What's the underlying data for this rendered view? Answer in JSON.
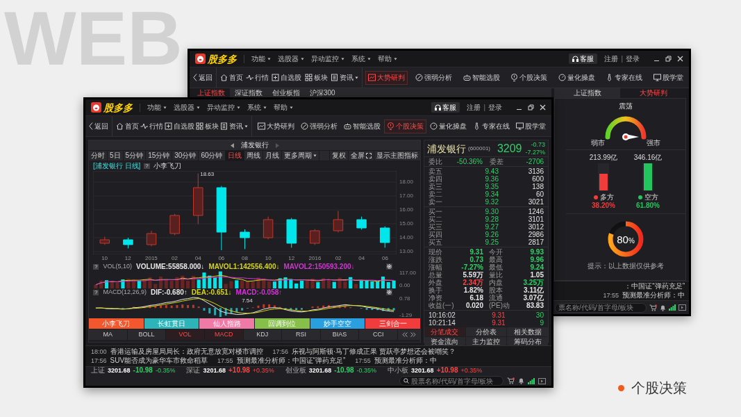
{
  "background_text": "WEB",
  "caption": "个股决策",
  "back_window": {
    "logo": "股多多",
    "menus": [
      "功能",
      "选股器",
      "异动监控",
      "系统",
      "帮助"
    ],
    "service_button": "客服",
    "register": "注册",
    "separator": "|",
    "login": "登录",
    "back_button": "返回",
    "toolbar_left": [
      {
        "label": "首页",
        "dropdown": false
      },
      {
        "label": "行情",
        "dropdown": false
      },
      {
        "label": "自选股",
        "dropdown": false
      },
      {
        "label": "板块",
        "dropdown": false
      },
      {
        "label": "资讯",
        "dropdown": true
      }
    ],
    "toolbar_right": [
      {
        "label": "大势研判",
        "selected": true
      },
      {
        "label": "强弱分析",
        "selected": false
      },
      {
        "label": "智能选股",
        "selected": false
      },
      {
        "label": "个股决策",
        "selected": false
      },
      {
        "label": "量化操盘",
        "selected": false
      },
      {
        "label": "专家在线",
        "selected": false
      },
      {
        "label": "股学堂",
        "selected": false
      }
    ],
    "index_tabs": [
      {
        "label": "上证指数",
        "selected": true
      },
      {
        "label": "深证指数",
        "selected": false
      },
      {
        "label": "创业板指",
        "selected": false
      },
      {
        "label": "沪深300",
        "selected": false
      }
    ],
    "side_tabs": [
      {
        "label": "上证指数",
        "selected": false
      },
      {
        "label": "大势研判",
        "selected": true
      }
    ],
    "gauge": {
      "title": "震荡",
      "left_label": "弱市",
      "right_label": "强市"
    },
    "balance": [
      {
        "amount": "213.99亿",
        "label": "多方",
        "share": "38.20%",
        "color": "#f23b3b",
        "level": 0.62
      },
      {
        "amount": "346.16亿",
        "label": "空方",
        "share": "61.80%",
        "color": "#22c55e",
        "level": 1
      }
    ],
    "donut": {
      "value": "80",
      "unit": "%",
      "level": 0.8
    },
    "tip": "提示：以上数据仅供参考",
    "ticker": [
      {
        "text": "：中国证“弹药充足”"
      },
      {
        "time": "17:55",
        "text": "预测最准分析师：中"
      }
    ],
    "search": {
      "placeholder": "票名称/代码/首字母/板块"
    }
  },
  "front_window": {
    "logo": "股多多",
    "menus": [
      "功能",
      "选股器",
      "异动监控",
      "系统",
      "帮助"
    ],
    "service_button": "客服",
    "register": "注册",
    "separator": "|",
    "login": "登录",
    "back_button": "返回",
    "toolbar_left": [
      {
        "label": "首页",
        "dropdown": false
      },
      {
        "label": "行情",
        "dropdown": false
      },
      {
        "label": "自选股",
        "dropdown": false
      },
      {
        "label": "板块",
        "dropdown": false
      },
      {
        "label": "资讯",
        "dropdown": true
      }
    ],
    "toolbar_right": [
      {
        "label": "大势研判",
        "selected": false
      },
      {
        "label": "强弱分析",
        "selected": false
      },
      {
        "label": "智能选股",
        "selected": false
      },
      {
        "label": "个股决策",
        "selected": true
      },
      {
        "label": "量化操盘",
        "selected": false
      },
      {
        "label": "专家在线",
        "selected": false
      },
      {
        "label": "股学堂",
        "selected": false
      }
    ],
    "chart": {
      "stock_title": "浦发银行",
      "periods": [
        {
          "label": "分时",
          "selected": false
        },
        {
          "label": "5日",
          "selected": false
        },
        {
          "label": "5分钟",
          "selected": false
        },
        {
          "label": "15分钟",
          "selected": false
        },
        {
          "label": "30分钟",
          "selected": false
        },
        {
          "label": "60分钟",
          "selected": false
        },
        {
          "label": "日线",
          "selected": true
        },
        {
          "label": "周线",
          "selected": false
        },
        {
          "label": "月线",
          "selected": false
        },
        {
          "label": "更多周期",
          "selected": false
        }
      ],
      "tools": [
        "复权",
        "全屏",
        "显示主图指标"
      ],
      "legend": {
        "series": "[浦发银行 日线]",
        "help": "?",
        "indicator": "小李飞刀"
      },
      "chart_data": {
        "type": "candlestick",
        "grid": true,
        "categories": [
          "10",
          "12",
          "2015",
          "02",
          "04",
          "06",
          "08",
          "10",
          "12",
          "2016",
          "02",
          "04",
          "06"
        ],
        "ohlc": [
          [
            13.6,
            14.07,
            13.48,
            13.85
          ],
          [
            13.85,
            14.0,
            13.23,
            13.5
          ],
          [
            13.5,
            14.5,
            13.38,
            14.3
          ],
          [
            14.3,
            15.72,
            14.18,
            15.6
          ],
          [
            15.6,
            18.63,
            14.98,
            17.6
          ],
          [
            17.6,
            17.72,
            13.1,
            14.4
          ],
          [
            14.4,
            14.6,
            13.18,
            14.0
          ],
          [
            14.0,
            15.52,
            13.88,
            15.3
          ],
          [
            15.3,
            15.42,
            13.28,
            13.6
          ],
          [
            13.6,
            14.62,
            13.48,
            14.5
          ],
          [
            14.5,
            15.92,
            14.38,
            15.3
          ],
          [
            15.3,
            15.52,
            14.58,
            14.7
          ],
          [
            14.7,
            14.82,
            13.28,
            13.65
          ]
        ],
        "ylim": [
          12.8,
          18.8
        ],
        "yticks": [
          {
            "value": 18,
            "label": "18.00"
          },
          {
            "value": 17,
            "label": "17.00"
          },
          {
            "value": 16,
            "label": "16.00"
          },
          {
            "value": 15,
            "label": "15.00"
          },
          {
            "value": 14,
            "label": "14.00"
          },
          {
            "value": 13,
            "label": "13.00"
          }
        ],
        "annotations": [
          "18.63"
        ]
      },
      "volume": {
        "help": "?",
        "title": "VOL(5,10)",
        "items": [
          {
            "text": "VOLUME:55858.000↓",
            "color": "#e8e8e8"
          },
          {
            "text": "MAVOL1:142556.400↓",
            "color": "#d6d617"
          },
          {
            "text": "MAVOL2:150593.200↓",
            "color": "#d633d6"
          }
        ],
        "axis": [
          "117.00",
          "0.00"
        ]
      },
      "macd": {
        "help": "?",
        "title": "MACD(12,26,9)",
        "items": [
          {
            "text": "DIF:-0.680↑",
            "color": "#e8e8e8"
          },
          {
            "text": "DEA:-0.651↓",
            "color": "#d6d617"
          },
          {
            "text": "MACD:-0.058↑",
            "color": "#d633d6"
          }
        ],
        "axis": [
          "0.78",
          "-1.29"
        ],
        "peak_label": "7.54"
      },
      "strategies": [
        {
          "label": "小李飞刀",
          "color": "#f2572d"
        },
        {
          "label": "长虹贯日",
          "color": "#2eb3b8"
        },
        {
          "label": "仙人指路",
          "color": "#f07aa6"
        },
        {
          "label": "回调到位",
          "color": "#86bf4a"
        },
        {
          "label": "妙手空空",
          "color": "#2a9fe0"
        },
        {
          "label": "三剑合一",
          "color": "#f03c3c"
        }
      ],
      "indicators": [
        {
          "label": "MA",
          "selected": false
        },
        {
          "label": "BOLL",
          "selected": false
        },
        {
          "label": "VOL",
          "selected": true
        },
        {
          "label": "MACD",
          "selected": true
        },
        {
          "label": "KDJ",
          "selected": false
        },
        {
          "label": "RSI",
          "selected": false
        },
        {
          "label": "BIAS",
          "selected": false
        },
        {
          "label": "CCI",
          "selected": false
        }
      ]
    },
    "quote": {
      "name": "浦发银行",
      "code": "(600001)",
      "price": "3209",
      "change": "-0.73",
      "change_pct": "-7.27%",
      "ratio": [
        {
          "label": "委比",
          "value": "-50.36%"
        },
        {
          "label": "委差",
          "value": "-2706"
        }
      ],
      "asks": [
        {
          "label": "卖五",
          "price": "9.43",
          "volume": "3136"
        },
        {
          "label": "卖四",
          "price": "9.36",
          "volume": "600"
        },
        {
          "label": "卖三",
          "price": "9.35",
          "volume": "138"
        },
        {
          "label": "卖二",
          "price": "9.34",
          "volume": "60"
        },
        {
          "label": "卖一",
          "price": "9.32",
          "volume": "3021"
        }
      ],
      "bids": [
        {
          "label": "买一",
          "price": "9.30",
          "volume": "1246"
        },
        {
          "label": "买二",
          "price": "9.28",
          "volume": "3101"
        },
        {
          "label": "买三",
          "price": "9.27",
          "volume": "3012"
        },
        {
          "label": "买四",
          "price": "9.26",
          "volume": "2986"
        },
        {
          "label": "买五",
          "price": "9.25",
          "volume": "2817"
        }
      ],
      "stats": [
        {
          "label": "现价",
          "value": "9.31",
          "color": "#2fd266"
        },
        {
          "label": "今开",
          "value": "9.93",
          "color": "#2fd266"
        },
        {
          "label": "涨跌",
          "value": "0.73",
          "color": "#2fd266"
        },
        {
          "label": "最高",
          "value": "9.96",
          "color": "#2fd266"
        },
        {
          "label": "涨幅",
          "value": "-7.27%",
          "color": "#2fd266"
        },
        {
          "label": "最低",
          "value": "9.24",
          "color": "#2fd266"
        },
        {
          "label": "总量",
          "value": "5.59万",
          "color": "#e6e6e6"
        },
        {
          "label": "量比",
          "value": "1.05",
          "color": "#e6e6e6"
        },
        {
          "label": "外盘",
          "value": "2.34万",
          "color": "#ff4646"
        },
        {
          "label": "内盘",
          "value": "3.25万",
          "color": "#2fd266"
        },
        {
          "label": "换手",
          "value": "1.82%",
          "color": "#e6e6e6"
        },
        {
          "label": "股本",
          "value": "3.11亿",
          "color": "#e6e6e6"
        },
        {
          "label": "净资",
          "value": "6.18",
          "color": "#e6e6e6"
        },
        {
          "label": "流通",
          "value": "3.07亿",
          "color": "#e6e6e6"
        },
        {
          "label": "收益(一)",
          "value": "0.020",
          "color": "#e6e6e6"
        },
        {
          "label": "(PE)动",
          "value": "83.83",
          "color": "#e6e6e6"
        }
      ],
      "trades": [
        {
          "time": "10:16:02",
          "price": "9.31",
          "volume": "30"
        },
        {
          "time": "10:21:14",
          "price": "9.31",
          "volume": "9"
        }
      ],
      "tabs": [
        {
          "label": "分笔成交",
          "selected": true
        },
        {
          "label": "分价表",
          "selected": false
        },
        {
          "label": "相关数据",
          "selected": false
        },
        {
          "label": "资金流向",
          "selected": false
        },
        {
          "label": "主力监控",
          "selected": false
        },
        {
          "label": "筹码分布",
          "selected": false
        }
      ]
    },
    "ticker": [
      {
        "time": "18:00",
        "text": "香港运输及房屋局局长：政府无意放宽对楼市调控"
      },
      {
        "time": "17:56",
        "text": "乐视与阿斯顿·马丁修成正果 贾跃亭梦想还会被嘲笑？"
      },
      {
        "time": "17:56",
        "text": "SUV能否成为豪华车市救命稻草"
      },
      {
        "time": "17:55",
        "text": "预测最准分析师：中国证“弹药充足”"
      },
      {
        "time": "17:55",
        "text": "预测最准分析师：中"
      }
    ],
    "indices": [
      {
        "name": "上证",
        "value": "3201.68",
        "change": "-10.98",
        "change_pct": "-0.35%",
        "color": "#2fd266"
      },
      {
        "name": "深证",
        "value": "3201.68",
        "change": "+10.98",
        "change_pct": "+0.35%",
        "color": "#ff4646"
      },
      {
        "name": "创业板",
        "value": "3201.68",
        "change": "-10.98",
        "change_pct": "-0.35%",
        "color": "#2fd266"
      },
      {
        "name": "中小板",
        "value": "3201.68",
        "change": "+10.98",
        "change_pct": "+0.35%",
        "color": "#ff4646"
      }
    ],
    "search": {
      "placeholder": "股票名称/代码/首字母/板块"
    }
  }
}
